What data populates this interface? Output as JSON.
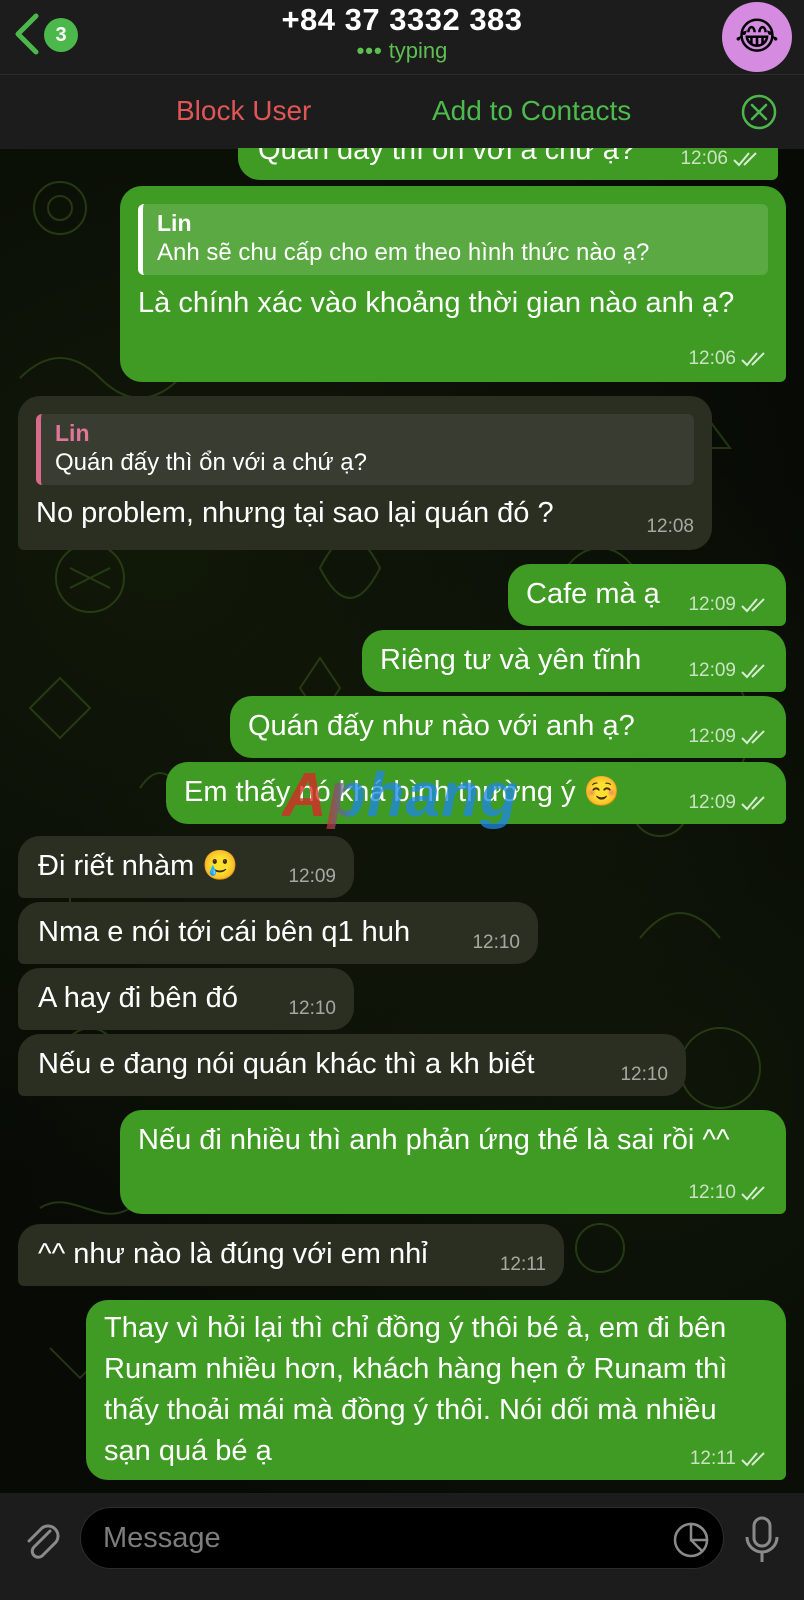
{
  "header": {
    "unread_count": "3",
    "title": "+84 37 3332 383",
    "status_dots": "•••",
    "status": "typing",
    "avatar_emoji": "😂"
  },
  "action_bar": {
    "block_label": "Block User",
    "add_label": "Add to Contacts"
  },
  "messages": [
    {
      "direction": "out",
      "text": "Quán đấy thì ổn với a chứ ạ?",
      "time": "12:06",
      "read": true
    },
    {
      "direction": "out",
      "reply": {
        "name": "Lin",
        "text": "Anh sẽ chu cấp cho em theo hình thức nào ạ?"
      },
      "text": "Là chính xác vào khoảng thời gian nào anh ạ?",
      "time": "12:06",
      "read": true
    },
    {
      "direction": "in",
      "reply": {
        "name": "Lin",
        "text": "Quán đấy thì ổn với a chứ ạ?"
      },
      "text": "No problem, nhưng tại sao lại quán đó ?",
      "time": "12:08"
    },
    {
      "direction": "out",
      "text": "Cafe mà ạ",
      "time": "12:09",
      "read": true
    },
    {
      "direction": "out",
      "text": "Riêng tư và yên tĩnh",
      "time": "12:09",
      "read": true
    },
    {
      "direction": "out",
      "text": "Quán đấy như nào với anh ạ?",
      "time": "12:09",
      "read": true
    },
    {
      "direction": "out",
      "text": "Em thấy nó khá bình thường ý ☺️",
      "time": "12:09",
      "read": true
    },
    {
      "direction": "in",
      "text": "Đi riết nhàm 🥲",
      "time": "12:09"
    },
    {
      "direction": "in",
      "text": "Nma e nói tới cái bên q1 huh",
      "time": "12:10"
    },
    {
      "direction": "in",
      "text": "A hay đi bên đó",
      "time": "12:10"
    },
    {
      "direction": "in",
      "text": "Nếu e đang nói quán khác thì a kh biết",
      "time": "12:10"
    },
    {
      "direction": "out",
      "text": "Nếu đi nhiều thì anh phản ứng thế là sai rồi ^^",
      "time": "12:10",
      "read": true
    },
    {
      "direction": "in",
      "text": "^^ như nào là đúng với em nhỉ",
      "time": "12:11"
    },
    {
      "direction": "out",
      "text": "Thay vì hỏi lại thì chỉ đồng ý thôi bé à, em đi bên Runam nhiều hơn, khách hàng hẹn ở Runam thì thấy thoải mái mà đồng ý thôi. Nói dối mà nhiều sạn quá bé ạ",
      "time": "12:11",
      "read": true
    }
  ],
  "watermark": "Aphang",
  "composer": {
    "placeholder": "Message"
  },
  "colors": {
    "outgoing_bubble": "#3f9b24",
    "incoming_bubble": "#2a2f22",
    "block_red": "#e05555",
    "add_green": "#4cbb4c",
    "badge_green": "#4cb84c"
  },
  "icons": [
    "back-chevron-icon",
    "close-icon",
    "read-ticks-icon",
    "attach-icon",
    "sticker-icon",
    "microphone-icon"
  ]
}
